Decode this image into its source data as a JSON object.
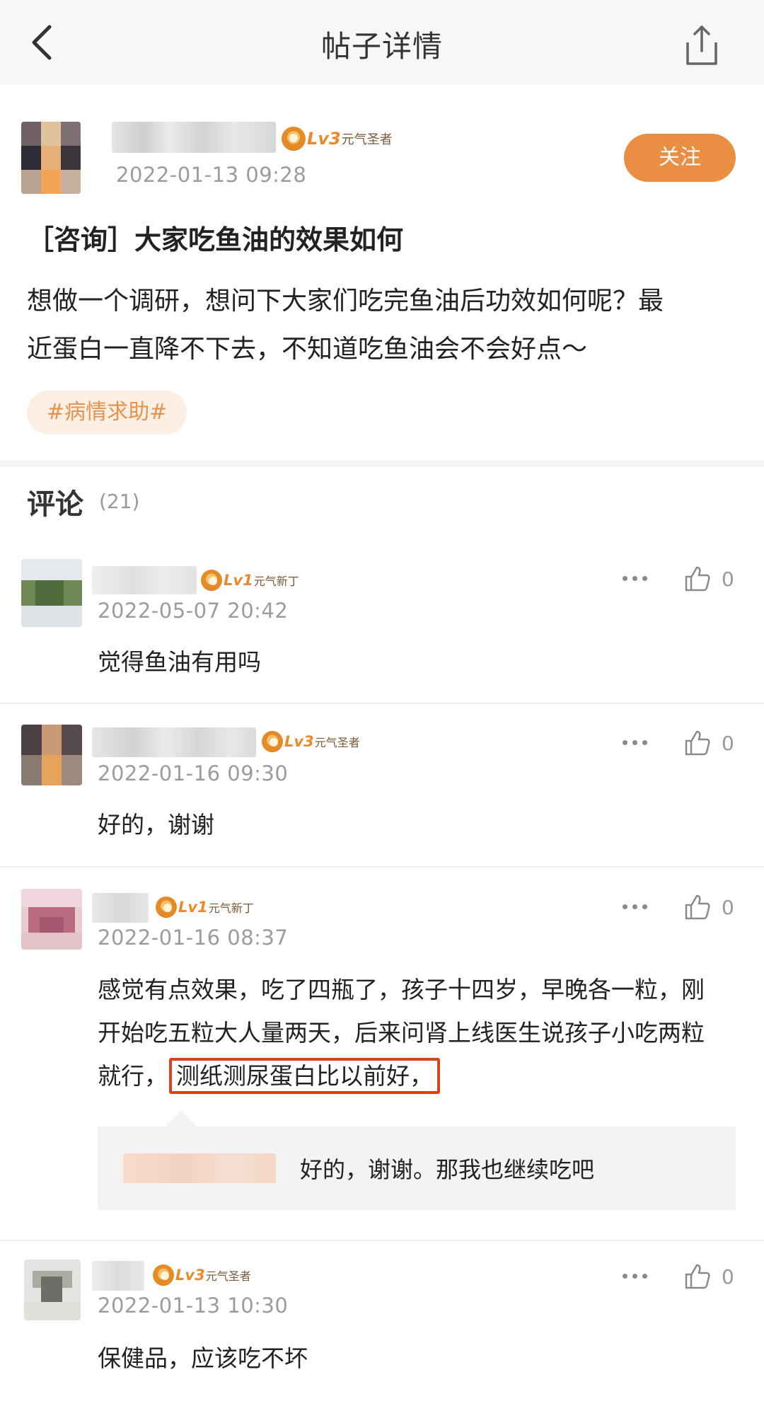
{
  "header": {
    "title": "帖子详情"
  },
  "post": {
    "badge_level": "Lv3",
    "badge_rank": "元气圣者",
    "time": "2022-01-13 09:28",
    "follow_label": "关注",
    "title": "［咨询］大家吃鱼油的效果如何",
    "body_line1": "想做一个调研，想问下大家们吃完鱼油后功效如何呢？最",
    "body_line2": "近蛋白一直降不下去，不知道吃鱼油会不会好点～",
    "tag": "#病情求助#"
  },
  "comments_section": {
    "title": "评论",
    "count": "(21)"
  },
  "comments": [
    {
      "badge_level": "Lv1",
      "badge_rank": "元气新丁",
      "time": "2022-05-07 20:42",
      "likes": "0",
      "text": "觉得鱼油有用吗"
    },
    {
      "badge_level": "Lv3",
      "badge_rank": "元气圣者",
      "time": "2022-01-16 09:30",
      "likes": "0",
      "text": "好的，谢谢"
    },
    {
      "badge_level": "Lv1",
      "badge_rank": "元气新丁",
      "time": "2022-01-16 08:37",
      "likes": "0",
      "text_line1": "感觉有点效果，吃了四瓶了，孩子十四岁，早晚各一粒，刚",
      "text_line2": "开始吃五粒大人量两天，后来问肾上线医生说孩子小吃两粒",
      "text_line3_prefix": "就行，",
      "text_highlight": "测纸测尿蛋白比以前好，",
      "reply_text": "好的，谢谢。那我也继续吃吧"
    },
    {
      "badge_level": "Lv3",
      "badge_rank": "元气圣者",
      "time": "2022-01-13 10:30",
      "likes": "0",
      "text": "保健品，应该吃不坏"
    }
  ],
  "colors": {
    "accent": "#e98e43",
    "highlight_border": "#d8431c",
    "tag_bg": "#fbeee2",
    "time_gray": "#9c9c9c"
  }
}
